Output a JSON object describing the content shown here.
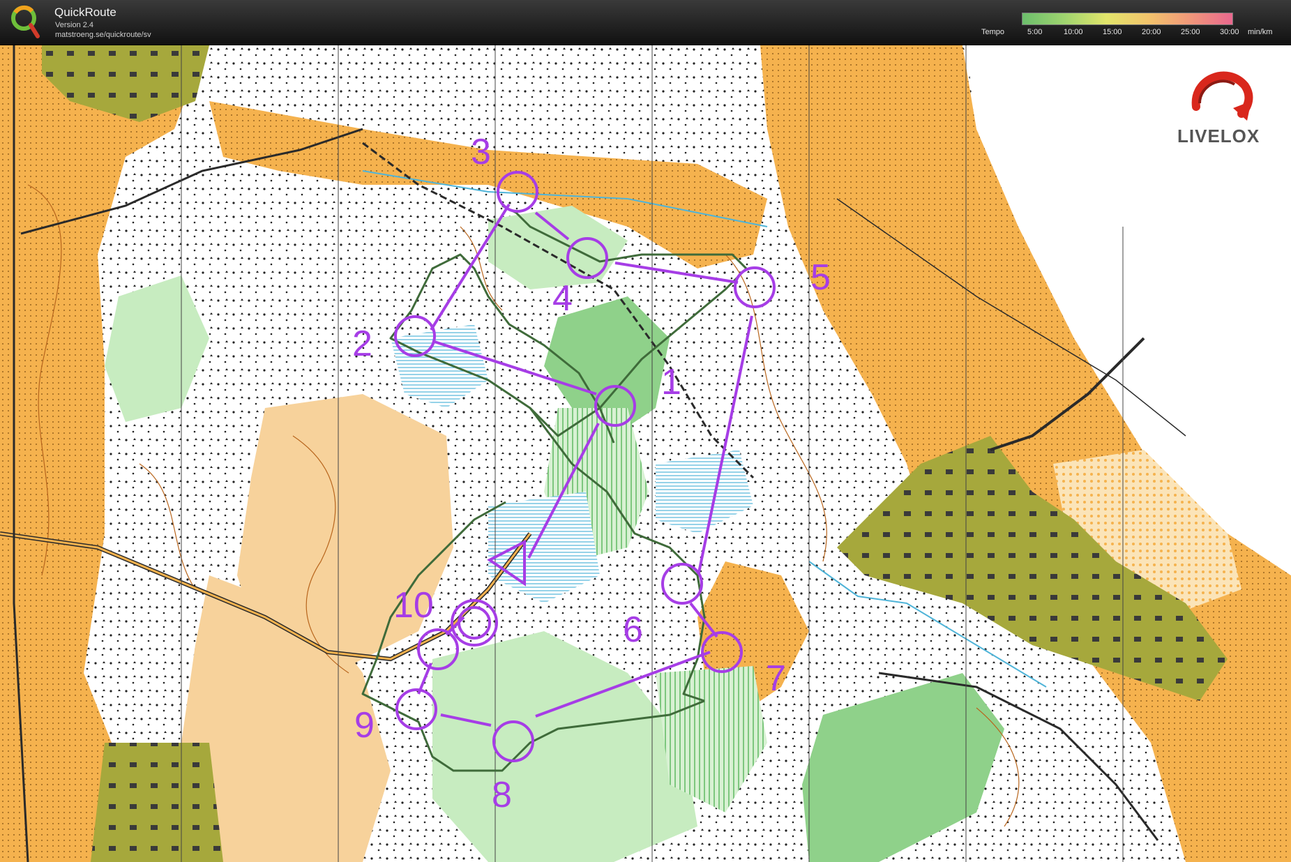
{
  "app": {
    "name": "QuickRoute",
    "version": "Version 2.4",
    "url": "matstroeng.se/quickroute/sv"
  },
  "tempo": {
    "label": "Tempo",
    "ticks": [
      "5:00",
      "10:00",
      "15:00",
      "20:00",
      "25:00",
      "30:00"
    ],
    "unit": "min/km",
    "colors": [
      "#6cbf6c",
      "#9fd46f",
      "#e2e56b",
      "#f3c46c",
      "#f1977a",
      "#e9688e"
    ]
  },
  "branding": {
    "logo_text": "LIVELOX",
    "accent_color": "#d9271c"
  },
  "course": {
    "color": "#a63de6",
    "controls": [
      {
        "number": "1"
      },
      {
        "number": "2"
      },
      {
        "number": "3"
      },
      {
        "number": "4"
      },
      {
        "number": "5"
      },
      {
        "number": "6"
      },
      {
        "number": "7"
      },
      {
        "number": "8"
      },
      {
        "number": "9"
      },
      {
        "number": "10"
      }
    ]
  },
  "map_colors": {
    "open_land": "#f5b24e",
    "rough_open": "#f7d29b",
    "forest": "#ffffff",
    "green": "#8fd18a",
    "light_green": "#c7ecc0",
    "settlement": "#a6a83c",
    "water": "#4fb4d8",
    "contour": "#b8651c",
    "route": "#3f6b3a"
  }
}
